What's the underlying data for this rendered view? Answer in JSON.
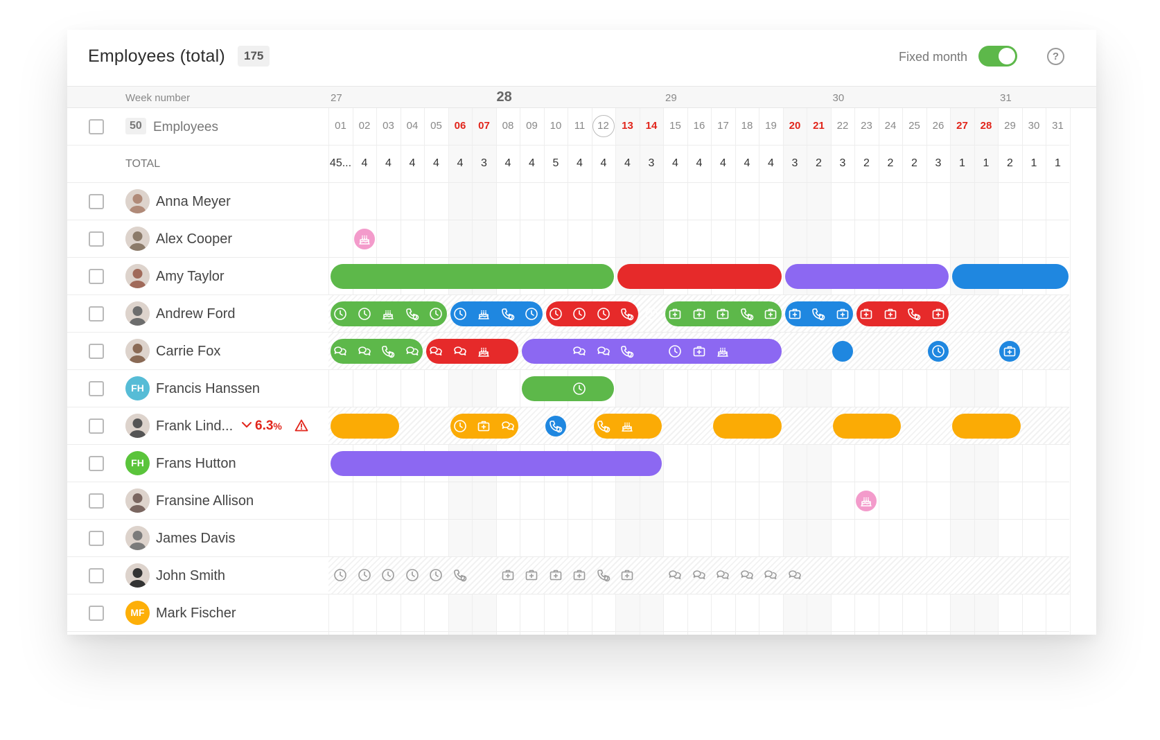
{
  "header": {
    "title": "Employees (total)",
    "total_count": "175",
    "fixed_month_label": "Fixed month",
    "fixed_month_on": true,
    "help_symbol": "?"
  },
  "weeks": {
    "label": "Week number",
    "numbers": [
      {
        "num": "27",
        "day": 1,
        "current": false
      },
      {
        "num": "28",
        "day": 8,
        "current": true
      },
      {
        "num": "29",
        "day": 15,
        "current": false
      },
      {
        "num": "30",
        "day": 22,
        "current": false
      },
      {
        "num": "31",
        "day": 29,
        "current": false
      }
    ]
  },
  "days_header": {
    "employee_count": "50",
    "employee_label": "Employees",
    "days": [
      "01",
      "02",
      "03",
      "04",
      "05",
      "06",
      "07",
      "08",
      "09",
      "10",
      "11",
      "12",
      "13",
      "14",
      "15",
      "16",
      "17",
      "18",
      "19",
      "20",
      "21",
      "22",
      "23",
      "24",
      "25",
      "26",
      "27",
      "28",
      "29",
      "30",
      "31"
    ],
    "weekends": [
      6,
      7,
      13,
      14,
      20,
      21,
      27,
      28
    ],
    "today": 12
  },
  "totals": {
    "label": "TOTAL",
    "values": [
      "45...",
      "4",
      "4",
      "4",
      "4",
      "4",
      "3",
      "4",
      "4",
      "5",
      "4",
      "4",
      "4",
      "3",
      "4",
      "4",
      "4",
      "4",
      "4",
      "3",
      "2",
      "3",
      "2",
      "2",
      "2",
      "3",
      "1",
      "1",
      "2",
      "1",
      "1"
    ]
  },
  "colors": {
    "green": "#5db84a",
    "red": "#e62a2a",
    "purple": "#8c68f2",
    "blue": "#1f87e0",
    "orange": "#fbab05",
    "pink": "#f39bcb",
    "alert": "#e1251b",
    "avatar_teal": "#56bcd6",
    "avatar_green": "#5ac43b",
    "avatar_orange": "#fdaf08"
  },
  "employees": [
    {
      "name": "Anna Meyer",
      "avatar": {
        "type": "photo",
        "tone": "#b08a78"
      },
      "hatched": false,
      "events": []
    },
    {
      "name": "Alex Cooper",
      "avatar": {
        "type": "photo",
        "tone": "#8c7b6a"
      },
      "hatched": false,
      "events": [
        {
          "kind": "dot",
          "day": 2,
          "color": "pink",
          "icon": "cake-icon"
        }
      ]
    },
    {
      "name": "Amy Taylor",
      "avatar": {
        "type": "photo",
        "tone": "#a06a5a"
      },
      "hatched": false,
      "events": [
        {
          "kind": "bar",
          "start": 1,
          "end": 12,
          "color": "green",
          "icons": []
        },
        {
          "kind": "bar",
          "start": 13,
          "end": 19,
          "color": "red",
          "icons": []
        },
        {
          "kind": "bar",
          "start": 20,
          "end": 26,
          "color": "purple",
          "icons": []
        },
        {
          "kind": "bar",
          "start": 27,
          "end": 31,
          "color": "blue",
          "icons": []
        }
      ]
    },
    {
      "name": "Andrew Ford",
      "avatar": {
        "type": "photo",
        "tone": "#6d6d6d"
      },
      "hatched": true,
      "events": [
        {
          "kind": "bar",
          "start": 1,
          "end": 5,
          "color": "green",
          "icons": [
            {
              "day": 1,
              "icon": "clock-icon"
            },
            {
              "day": 2,
              "icon": "clock-icon"
            },
            {
              "day": 3,
              "icon": "cake-icon"
            },
            {
              "day": 4,
              "icon": "phone-icon"
            },
            {
              "day": 5,
              "icon": "clock-icon"
            }
          ]
        },
        {
          "kind": "bar",
          "start": 6,
          "end": 9,
          "color": "blue",
          "icons": [
            {
              "day": 6,
              "icon": "clock-icon"
            },
            {
              "day": 7,
              "icon": "cake-icon"
            },
            {
              "day": 8,
              "icon": "phone-icon"
            },
            {
              "day": 9,
              "icon": "clock-icon"
            }
          ]
        },
        {
          "kind": "bar",
          "start": 10,
          "end": 13,
          "color": "red",
          "icons": [
            {
              "day": 10,
              "icon": "clock-icon"
            },
            {
              "day": 11,
              "icon": "clock-icon"
            },
            {
              "day": 12,
              "icon": "clock-icon"
            },
            {
              "day": 13,
              "icon": "phone-icon"
            },
            {
              "day": 14,
              "icon": "clock-icon"
            }
          ]
        },
        {
          "kind": "bar",
          "start": 15,
          "end": 19,
          "color": "green",
          "icons": [
            {
              "day": 15,
              "icon": "medkit-icon"
            },
            {
              "day": 16,
              "icon": "medkit-icon"
            },
            {
              "day": 17,
              "icon": "medkit-icon"
            },
            {
              "day": 18,
              "icon": "phone-icon"
            },
            {
              "day": 19,
              "icon": "medkit-icon"
            }
          ]
        },
        {
          "kind": "bar",
          "start": 20,
          "end": 22,
          "color": "blue",
          "icons": [
            {
              "day": 20,
              "icon": "medkit-icon"
            },
            {
              "day": 21,
              "icon": "phone-icon"
            },
            {
              "day": 22,
              "icon": "medkit-icon"
            }
          ]
        },
        {
          "kind": "bar",
          "start": 23,
          "end": 26,
          "color": "red",
          "icons": [
            {
              "day": 23,
              "icon": "medkit-icon"
            },
            {
              "day": 24,
              "icon": "medkit-icon"
            },
            {
              "day": 25,
              "icon": "phone-icon"
            },
            {
              "day": 26,
              "icon": "medkit-icon"
            }
          ]
        }
      ]
    },
    {
      "name": "Carrie Fox",
      "avatar": {
        "type": "photo",
        "tone": "#8a6a55"
      },
      "hatched": true,
      "events": [
        {
          "kind": "bar",
          "start": 1,
          "end": 4,
          "color": "green",
          "icons": [
            {
              "day": 1,
              "icon": "chat-icon"
            },
            {
              "day": 2,
              "icon": "chat-icon"
            },
            {
              "day": 3,
              "icon": "phone-icon"
            },
            {
              "day": 4,
              "icon": "chat-icon"
            }
          ]
        },
        {
          "kind": "bar",
          "start": 5,
          "end": 8,
          "color": "red",
          "icons": [
            {
              "day": 5,
              "icon": "chat-icon"
            },
            {
              "day": 6,
              "icon": "chat-icon"
            },
            {
              "day": 7,
              "icon": "cake-icon"
            }
          ]
        },
        {
          "kind": "bar",
          "start": 9,
          "end": 19,
          "color": "purple",
          "icons": [
            {
              "day": 11,
              "icon": "chat-icon"
            },
            {
              "day": 12,
              "icon": "chat-icon"
            },
            {
              "day": 13,
              "icon": "phone-icon"
            },
            {
              "day": 15,
              "icon": "clock-icon"
            },
            {
              "day": 16,
              "icon": "medkit-icon"
            },
            {
              "day": 17,
              "icon": "cake-icon"
            }
          ]
        },
        {
          "kind": "dot",
          "day": 22,
          "color": "blue",
          "icon": ""
        },
        {
          "kind": "dot",
          "day": 26,
          "color": "blue",
          "icon": "clock-icon"
        },
        {
          "kind": "dot",
          "day": 29,
          "color": "blue",
          "icon": "medkit-icon"
        }
      ]
    },
    {
      "name": "Francis Hanssen",
      "avatar": {
        "type": "initials",
        "initials": "FH",
        "color": "avatar_teal"
      },
      "hatched": false,
      "events": [
        {
          "kind": "bar",
          "start": 9,
          "end": 12,
          "color": "green",
          "icons": [
            {
              "day": 11,
              "icon": "clock-icon"
            }
          ]
        }
      ]
    },
    {
      "name": "Frank Lind...",
      "avatar": {
        "type": "photo",
        "tone": "#555555"
      },
      "hatched": true,
      "warning": {
        "value": "6.3",
        "unit": "%"
      },
      "events": [
        {
          "kind": "bar",
          "start": 1,
          "end": 3,
          "color": "orange",
          "icons": []
        },
        {
          "kind": "bar",
          "start": 6,
          "end": 8,
          "color": "orange",
          "icons": [
            {
              "day": 6,
              "icon": "clock-icon"
            },
            {
              "day": 7,
              "icon": "medkit-icon"
            },
            {
              "day": 8,
              "icon": "chat-icon"
            }
          ]
        },
        {
          "kind": "dot",
          "day": 10,
          "color": "blue",
          "icon": "phone-icon"
        },
        {
          "kind": "bar",
          "start": 12,
          "end": 14,
          "color": "orange",
          "icons": [
            {
              "day": 12,
              "icon": "phone-icon"
            },
            {
              "day": 13,
              "icon": "cake-icon"
            }
          ]
        },
        {
          "kind": "bar",
          "start": 17,
          "end": 19,
          "color": "orange",
          "icons": []
        },
        {
          "kind": "bar",
          "start": 22,
          "end": 24,
          "color": "orange",
          "icons": []
        },
        {
          "kind": "bar",
          "start": 27,
          "end": 29,
          "color": "orange",
          "icons": []
        }
      ]
    },
    {
      "name": "Frans Hutton",
      "avatar": {
        "type": "initials",
        "initials": "FH",
        "color": "avatar_green"
      },
      "hatched": false,
      "events": [
        {
          "kind": "bar",
          "start": 1,
          "end": 14,
          "color": "purple",
          "icons": []
        }
      ]
    },
    {
      "name": "Fransine Allison",
      "avatar": {
        "type": "photo",
        "tone": "#7a6660"
      },
      "hatched": false,
      "events": [
        {
          "kind": "dot",
          "day": 23,
          "color": "pink",
          "icon": "cake-icon"
        }
      ]
    },
    {
      "name": "James Davis",
      "avatar": {
        "type": "photo",
        "tone": "#7b7b7b"
      },
      "hatched": false,
      "events": []
    },
    {
      "name": "John Smith",
      "avatar": {
        "type": "photo",
        "tone": "#333333"
      },
      "hatched": true,
      "events": [
        {
          "kind": "free",
          "icons": [
            {
              "day": 1,
              "icon": "clock-icon"
            },
            {
              "day": 2,
              "icon": "clock-icon"
            },
            {
              "day": 3,
              "icon": "clock-icon"
            },
            {
              "day": 4,
              "icon": "clock-icon"
            },
            {
              "day": 5,
              "icon": "clock-icon"
            },
            {
              "day": 6,
              "icon": "phone-icon"
            },
            {
              "day": 8,
              "icon": "medkit-icon"
            },
            {
              "day": 9,
              "icon": "medkit-icon"
            },
            {
              "day": 10,
              "icon": "medkit-icon"
            },
            {
              "day": 11,
              "icon": "medkit-icon"
            },
            {
              "day": 12,
              "icon": "phone-icon"
            },
            {
              "day": 13,
              "icon": "medkit-icon"
            },
            {
              "day": 15,
              "icon": "chat-icon"
            },
            {
              "day": 16,
              "icon": "chat-icon"
            },
            {
              "day": 17,
              "icon": "chat-icon"
            },
            {
              "day": 18,
              "icon": "chat-icon"
            },
            {
              "day": 19,
              "icon": "chat-icon"
            },
            {
              "day": 20,
              "icon": "chat-icon"
            }
          ]
        }
      ]
    },
    {
      "name": "Mark Fischer",
      "avatar": {
        "type": "initials",
        "initials": "MF",
        "color": "avatar_orange"
      },
      "hatched": false,
      "events": []
    }
  ]
}
